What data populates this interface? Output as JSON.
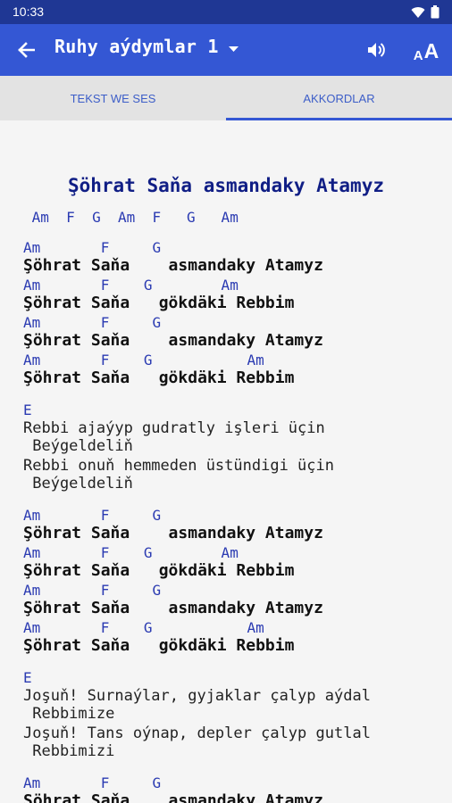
{
  "status": {
    "time": "10:33"
  },
  "appbar": {
    "title": "Ruhy aýdymlar 1"
  },
  "tabs": [
    {
      "label": "TEKST WE SES"
    },
    {
      "label": "AKKORDLAR"
    }
  ],
  "song": {
    "title": "Şöhrat Saňa asmandaky Atamyz",
    "lines": [
      {
        "kind": "chord",
        "text": " Am  F  G  Am  F   G   Am"
      },
      {
        "kind": "chord",
        "text": "Am       F     G"
      },
      {
        "kind": "lyric",
        "text": "Şöhrat Saňa    asmandaky Atamyz"
      },
      {
        "kind": "chord",
        "text": "Am       F    G        Am"
      },
      {
        "kind": "lyric",
        "text": "Şöhrat Saňa   gökdäki Rebbim"
      },
      {
        "kind": "chord",
        "text": "Am       F     G"
      },
      {
        "kind": "lyric",
        "text": "Şöhrat Saňa    asmandaky Atamyz"
      },
      {
        "kind": "chord",
        "text": "Am       F    G           Am"
      },
      {
        "kind": "lyric",
        "text": "Şöhrat Saňa   gökdäki Rebbim"
      },
      {
        "kind": "chord",
        "text": "E"
      },
      {
        "kind": "plain",
        "text": "Rebbi ajaýyp gudratly işleri üçin"
      },
      {
        "kind": "plain",
        "text": " Beýgeldeliň"
      },
      {
        "kind": "plain",
        "text": "Rebbi onuň hemmeden üstündigi üçin"
      },
      {
        "kind": "plain",
        "text": " Beýgeldeliň"
      },
      {
        "kind": "chord",
        "text": "Am       F     G"
      },
      {
        "kind": "lyric",
        "text": "Şöhrat Saňa    asmandaky Atamyz"
      },
      {
        "kind": "chord",
        "text": "Am       F    G        Am"
      },
      {
        "kind": "lyric",
        "text": "Şöhrat Saňa   gökdäki Rebbim"
      },
      {
        "kind": "chord",
        "text": "Am       F     G"
      },
      {
        "kind": "lyric",
        "text": "Şöhrat Saňa    asmandaky Atamyz"
      },
      {
        "kind": "chord",
        "text": "Am       F    G           Am"
      },
      {
        "kind": "lyric",
        "text": "Şöhrat Saňa   gökdäki Rebbim"
      },
      {
        "kind": "chord",
        "text": "E"
      },
      {
        "kind": "plain",
        "text": "Joşuň! Surnaýlar, gyjaklar çalyp aýdal"
      },
      {
        "kind": "plain",
        "text": " Rebbimize"
      },
      {
        "kind": "plain",
        "text": "Joşuň! Tans oýnap, depler çalyp gutlal"
      },
      {
        "kind": "plain",
        "text": " Rebbimizi"
      },
      {
        "kind": "chord",
        "text": "Am       F     G"
      },
      {
        "kind": "lyric",
        "text": "Şöhrat Saňa    asmandaky Atamyz"
      }
    ]
  }
}
